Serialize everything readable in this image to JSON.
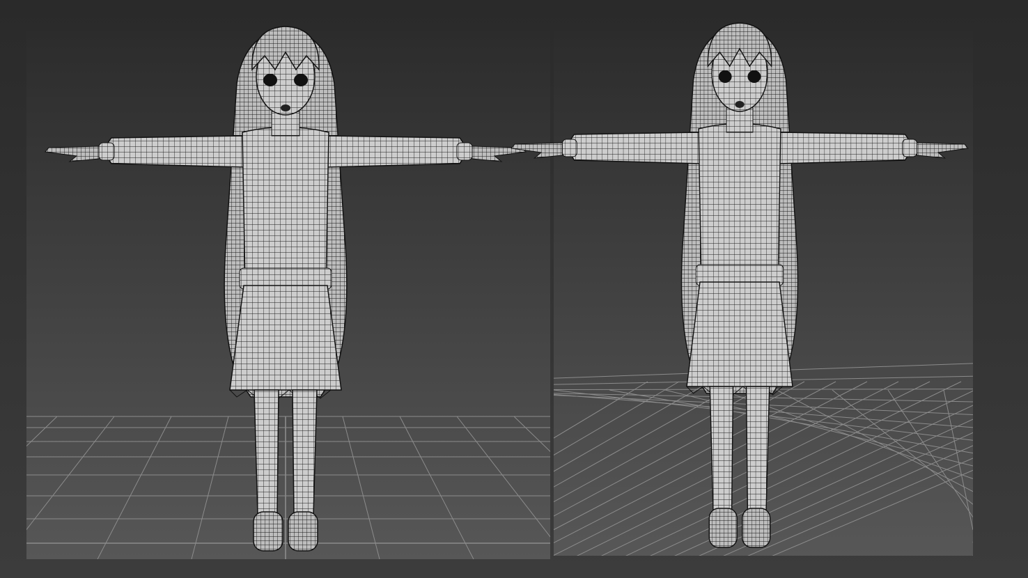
{
  "colors": {
    "background": "#363636",
    "viewport_top": "#2e2e2e",
    "viewport_bottom": "#555555",
    "grid_line": "#8a8a8a",
    "mesh_fill": "#cfcfcf",
    "mesh_wire": "#1a1a1a"
  },
  "viewports": [
    {
      "view": "front",
      "subject": "character-wireframe"
    },
    {
      "view": "perspective",
      "subject": "character-wireframe"
    }
  ]
}
